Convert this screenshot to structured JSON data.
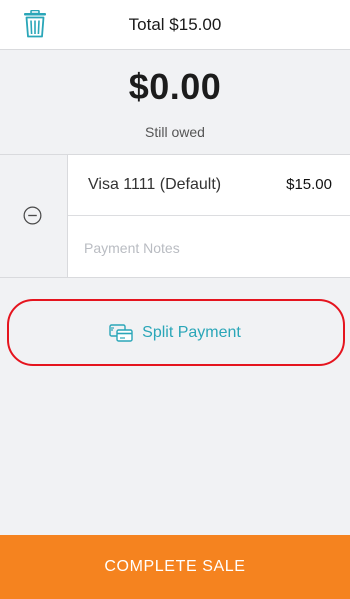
{
  "header": {
    "title": "Total $15.00",
    "delete_icon": "trash-icon"
  },
  "balance": {
    "amount": "$0.00",
    "caption": "Still owed"
  },
  "payment": {
    "remove_icon": "minus-circle-icon",
    "card_label": "Visa 1111 (Default)",
    "card_amount": "$15.00",
    "notes_placeholder": "Payment Notes",
    "notes_value": ""
  },
  "split": {
    "icon": "card-split-icon",
    "label": "Split Payment"
  },
  "footer": {
    "complete_label": "COMPLETE SALE"
  },
  "colors": {
    "accent_teal": "#2aa6b8",
    "complete_orange": "#f5831f",
    "highlight_red": "#e5141e"
  }
}
